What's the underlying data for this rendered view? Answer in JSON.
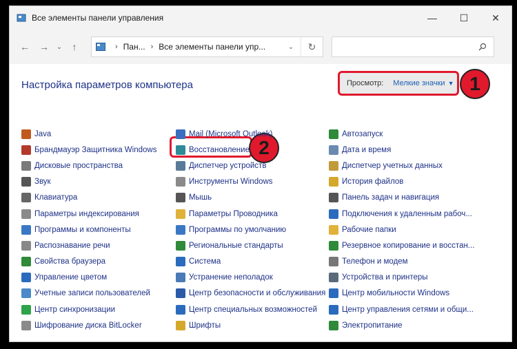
{
  "window": {
    "title": "Все элементы панели управления",
    "controls": {
      "minimize": "—",
      "maximize": "☐",
      "close": "✕"
    }
  },
  "addressbar": {
    "back": "←",
    "forward": "→",
    "recent": "⌄",
    "up": "↑",
    "crumbs": [
      "Пан...",
      "Все элементы панели упр..."
    ],
    "dropdown": "⌄",
    "refresh": "↻",
    "search_placeholder": ""
  },
  "header": {
    "title": "Настройка параметров компьютера",
    "view_label": "Просмотр:",
    "view_value": "Мелкие значки",
    "view_caret": "▼"
  },
  "badges": {
    "one": "1",
    "two": "2"
  },
  "columns": [
    [
      {
        "label": "Java",
        "icon": "java-icon",
        "color": "#c05a1e"
      },
      {
        "label": "Брандмауэр Защитника Windows",
        "icon": "firewall-icon",
        "color": "#b33a2a"
      },
      {
        "label": "Дисковые пространства",
        "icon": "storage-icon",
        "color": "#7a7a7a"
      },
      {
        "label": "Звук",
        "icon": "speaker-icon",
        "color": "#555555"
      },
      {
        "label": "Клавиатура",
        "icon": "keyboard-icon",
        "color": "#666666"
      },
      {
        "label": "Параметры индексирования",
        "icon": "indexing-icon",
        "color": "#8a8a8a"
      },
      {
        "label": "Программы и компоненты",
        "icon": "programs-icon",
        "color": "#3b78c4"
      },
      {
        "label": "Распознавание речи",
        "icon": "microphone-icon",
        "color": "#888888"
      },
      {
        "label": "Свойства браузера",
        "icon": "globe-icon",
        "color": "#2f8a3a"
      },
      {
        "label": "Управление цветом",
        "icon": "color-icon",
        "color": "#2b6bbd"
      },
      {
        "label": "Учетные записи пользователей",
        "icon": "users-icon",
        "color": "#4a8ac8"
      },
      {
        "label": "Центр синхронизации",
        "icon": "sync-icon",
        "color": "#2fa34a"
      },
      {
        "label": "Шифрование диска BitLocker",
        "icon": "bitlocker-icon",
        "color": "#8a8a8a"
      }
    ],
    [
      {
        "label": "Mail (Microsoft Outlook)",
        "icon": "mail-icon",
        "color": "#3a6ec0"
      },
      {
        "label": "Восстановление",
        "icon": "recovery-icon",
        "color": "#2f8a9a"
      },
      {
        "label": "Диспетчер устройств",
        "icon": "device-manager-icon",
        "color": "#5a7a9a"
      },
      {
        "label": "Инструменты Windows",
        "icon": "tools-icon",
        "color": "#8a8a8a"
      },
      {
        "label": "Мышь",
        "icon": "mouse-icon",
        "color": "#555555"
      },
      {
        "label": "Параметры Проводника",
        "icon": "folder-options-icon",
        "color": "#e0b23a"
      },
      {
        "label": "Программы по умолчанию",
        "icon": "default-programs-icon",
        "color": "#3b78c4"
      },
      {
        "label": "Региональные стандарты",
        "icon": "region-icon",
        "color": "#2f8a3a"
      },
      {
        "label": "Система",
        "icon": "system-icon",
        "color": "#2b6bbd"
      },
      {
        "label": "Устранение неполадок",
        "icon": "troubleshoot-icon",
        "color": "#4a7ab8"
      },
      {
        "label": "Центр безопасности и обслуживания",
        "icon": "security-flag-icon",
        "color": "#2b5aa8"
      },
      {
        "label": "Центр специальных возможностей",
        "icon": "accessibility-icon",
        "color": "#2b6bbd"
      },
      {
        "label": "Шрифты",
        "icon": "fonts-icon",
        "color": "#d4a82a"
      }
    ],
    [
      {
        "label": "Автозапуск",
        "icon": "autoplay-icon",
        "color": "#2f8a3a"
      },
      {
        "label": "Дата и время",
        "icon": "datetime-icon",
        "color": "#6a8ab0"
      },
      {
        "label": "Диспетчер учетных данных",
        "icon": "credentials-icon",
        "color": "#c29a3a"
      },
      {
        "label": "История файлов",
        "icon": "file-history-icon",
        "color": "#d4a82a"
      },
      {
        "label": "Панель задач и навигация",
        "icon": "taskbar-icon",
        "color": "#555555"
      },
      {
        "label": "Подключения к удаленным рабоч...",
        "icon": "remote-desktop-icon",
        "color": "#2b6bbd"
      },
      {
        "label": "Рабочие папки",
        "icon": "work-folders-icon",
        "color": "#e0b23a"
      },
      {
        "label": "Резервное копирование и восстан...",
        "icon": "backup-icon",
        "color": "#2f8a3a"
      },
      {
        "label": "Телефон и модем",
        "icon": "phone-icon",
        "color": "#777777"
      },
      {
        "label": "Устройства и принтеры",
        "icon": "printer-icon",
        "color": "#5a6a7a"
      },
      {
        "label": "Центр мобильности Windows",
        "icon": "mobility-icon",
        "color": "#2b6bbd"
      },
      {
        "label": "Центр управления сетями и общи...",
        "icon": "network-icon",
        "color": "#2b6bbd"
      },
      {
        "label": "Электропитание",
        "icon": "power-icon",
        "color": "#2f8a3a"
      }
    ]
  ]
}
